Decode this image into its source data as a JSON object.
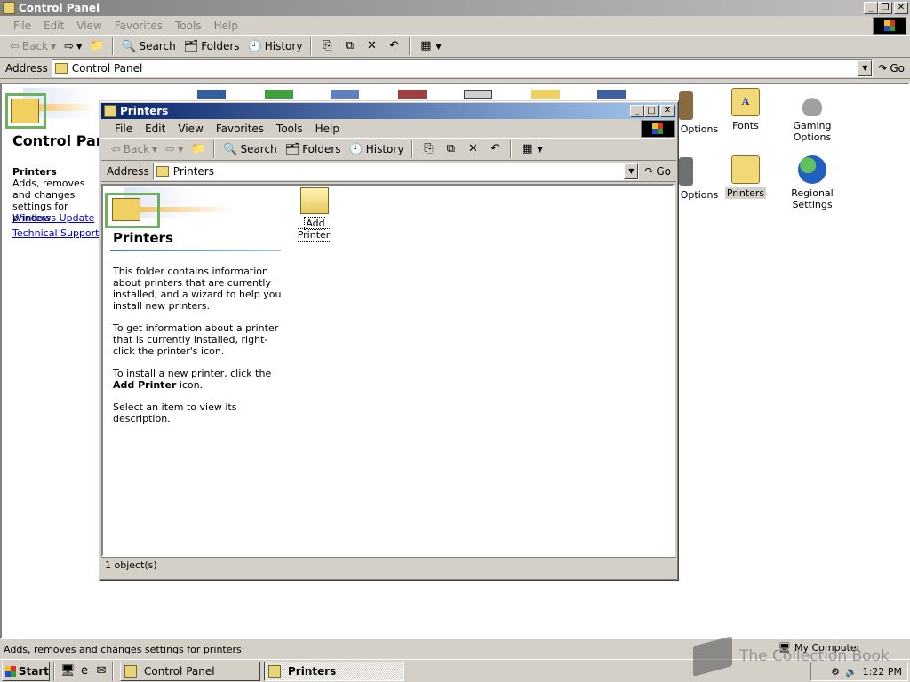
{
  "cp": {
    "title": "Control Panel",
    "menu": [
      "File",
      "Edit",
      "View",
      "Favorites",
      "Tools",
      "Help"
    ],
    "toolbar": {
      "back": "Back",
      "search": "Search",
      "folders": "Folders",
      "history": "History"
    },
    "address_label": "Address",
    "address_value": "Control Panel",
    "go": "Go",
    "panel_title": "Control Pan",
    "side_heading": "Printers",
    "side_desc": "Adds, removes and changes settings for printers.",
    "links": [
      "Windows Update",
      "Technical Support"
    ],
    "icons": {
      "options1": "Options",
      "fonts": "Fonts",
      "gaming": "Gaming Options",
      "options2": "Options",
      "printers": "Printers",
      "regional": "Regional Settings"
    },
    "status": "Adds, removes and changes settings for printers.",
    "status_right": "My Computer"
  },
  "pr": {
    "title": "Printers",
    "menu": [
      "File",
      "Edit",
      "View",
      "Favorites",
      "Tools",
      "Help"
    ],
    "toolbar": {
      "back": "Back",
      "search": "Search",
      "folders": "Folders",
      "history": "History"
    },
    "address_label": "Address",
    "address_value": "Printers",
    "go": "Go",
    "panel_title": "Printers",
    "desc": [
      "This folder contains information about printers that are currently installed, and a wizard to help you install new printers.",
      "To get information about a printer that is currently installed, right-click the printer's icon.",
      "Select an item to view its description."
    ],
    "desc_install_pre": "To install a new printer, click the ",
    "desc_install_bold": "Add Printer",
    "desc_install_post": " icon.",
    "add_printer": "Add Printer",
    "status": "1 object(s)"
  },
  "taskbar": {
    "start": "Start",
    "tasks": [
      "Control Panel",
      "Printers"
    ],
    "clock": "1:22 PM"
  },
  "watermark": "The Collection Book"
}
